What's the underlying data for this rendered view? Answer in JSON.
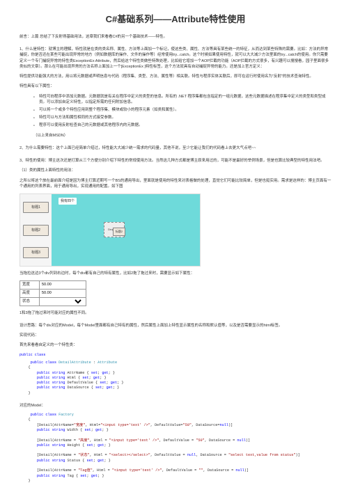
{
  "title": "C#基础系列——Attribute特性使用",
  "intro": "前言：上篇 总结了下反射得基础用法，这章我们来看看C#的另一个基础技术——特性。",
  "p1": "1、什么是特性：就博主的理解，特性就是在类的类名称、属性、方法等上面加一个标记，使这些类、属性、方法等具有某些统一的特征，从而达到某些特殊的需要。比如：方法的异常捕捉，你是否还在某些可能出现异常的地方（例如数据库的操作、文件的操作等）经常使用try...catch。这个时候如果使用特性，就可以大大减少方法里面的try...catch的使用。你只需要定义一个专门捕捉异常的特性类ExceptionEx Attribute，然后给这个特性类做些特殊处理，比如给它增加一个AOP拦截的功能（AOP拦截的方式很多，有兴趣可以搜搜看，园子里面很多类似的文章）。那么在可能出现异常的方法名称上面加上一个[ExceptionEx ]特性标签，这个方法就具有自动捕捉异常的能力。还是加上官方定义：",
  "p1b": "特性提供功能强大的方法，用以将元数据或声明信息与代码（程序集、类型、方法、属性等）相关联。特性与程序实体关联后，即可在运行时使用名为\"反射\"的技术查询特性。",
  "p1c": "特性具有以下属性：",
  "bullets": [
    "特性可向程序中添加元数据。元数据就是有关在程序中定义的类型的信息。所有的 .NET 程序集都包含指定的一组元数据，这些元数据描述在程序集中定义的类型和类型成员。可以添加自定义特性，以指定所需的任何附加信息。",
    "可以将一个或多个特性应用到整个程序集、模块或较小的程序元素（如类和属性）。",
    "特性可以与方法和属性相同的方式接受参数。",
    "程序可以使用反射检查自己的元数据或其他程序内的元数据。"
  ],
  "p1d": "（以上来自MSDN）",
  "p2": "2、为什么需要特性：这个上面已经简单介绍过，特性能大大减少统一需求的代码量，其他不说，至少它能让我们的代码看上去更大气点吧~~",
  "p3": "3、特性的使用：博主这次还是打算从三个方便分别介绍下特性的常规使用方法。当然这几种方式都是博主原来用过的，可能不是最好的举例场景，但是也算比较典型的特性用法吧。",
  "p3a": "（1）类的属性上面特性的用法：",
  "p3b": "之所以将这个放在最前面介绍是因为博主打算近期写一个BS的通用导出，里面就是使用的特性来对表格做的处理，直觉它们可能比较简单，但是也挺实用。需求是这样的：博主页面有一个通用的列表界面，用于通用导出，实现通用的配置。如下图",
  "tiles": [
    "标题1",
    "标题2",
    "标题3"
  ],
  "floatLabel": "我有四个",
  "dropLabel": "Drop here",
  "miniTile": "标题2",
  "p4": "当拖拉这边3个div列到右边时，每个div都有自己的特有属性，比如2拖了拖过来时，需要显示如下属性：",
  "formRows": [
    {
      "label": "宽度",
      "value": "50.00"
    },
    {
      "label": "高度",
      "value": "50.00"
    },
    {
      "label": "状态",
      "value": ""
    }
  ],
  "p5": "1和3拖了拖过来时可能对应的属性不同。",
  "p6": "设计思路：每个div对应的Model，每个Model里面都有自己特有的属性，然后属性上面加上特性显示属性的名称和默认值等，以及是否需要显示的html标签。",
  "p7": "实现代码：",
  "p8": "首先来看看自定义的一个特性类：",
  "code1": {
    "l1": "     public class DetailAttribute : Attribute",
    "l2": "    {",
    "l3": "        public string AttrName { set; get; }",
    "l4": "        public string Html { set; get; }",
    "l5": "        public string DefaultValue { set; get; }",
    "l6": "        public string DataSource { set; get; }",
    "l7": "    }"
  },
  "p9": "对应的Model：",
  "code2_header": "     public class Factory",
  "code2_open": "    {",
  "code2_a1": "        [Detail(AttrName=\"宽度\", Html=\"<input type='text' />\", DefaultValue=\"50\", DataSource=null)]",
  "code2_a2": "        public string Width { set; get; }",
  "code2_b1": "        [Detail(AttrName = \"高度\", Html = \"<input type='text' />\", DefaultValue = \"50\", DataSource = null)]",
  "code2_b2": "        public string Height { set; get; }",
  "code2_c1": "        [Detail(AttrName = \"状态\", Html = \"<select></select>\", DefaultValue = null, DataSource = \"select text,value from status\")]",
  "code2_c2": "        public string Status { set; get; }",
  "code2_d1": "        [Detail(AttrName = \"Tag值\", Html = \"<input type='text' />\", DefaultValue = \"\", DataSource = null)]",
  "code2_d2": "        public string Tag { set; get; }",
  "code2_close": "    }"
}
